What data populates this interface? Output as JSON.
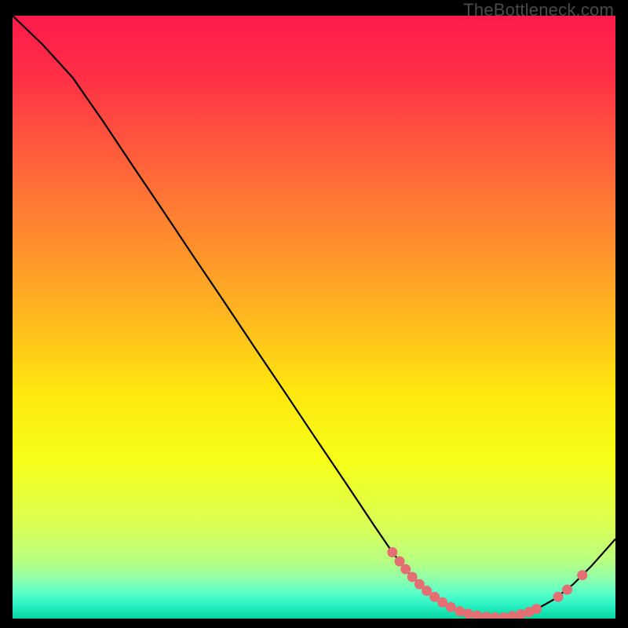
{
  "watermark": "TheBottleneck.com",
  "chart_data": {
    "type": "line",
    "title": "",
    "xlabel": "",
    "ylabel": "",
    "xlim": [
      0,
      100
    ],
    "ylim": [
      0,
      100
    ],
    "grid": false,
    "legend": false,
    "gradient_stops": [
      {
        "offset": 0.0,
        "color": "#ff1a4b"
      },
      {
        "offset": 0.1,
        "color": "#ff2f46"
      },
      {
        "offset": 0.22,
        "color": "#ff5a3c"
      },
      {
        "offset": 0.35,
        "color": "#ff8530"
      },
      {
        "offset": 0.5,
        "color": "#ffb81f"
      },
      {
        "offset": 0.62,
        "color": "#ffe60f"
      },
      {
        "offset": 0.74,
        "color": "#f6ff1a"
      },
      {
        "offset": 0.85,
        "color": "#d8ff58"
      },
      {
        "offset": 0.905,
        "color": "#b8ff82"
      },
      {
        "offset": 0.935,
        "color": "#8dffab"
      },
      {
        "offset": 0.955,
        "color": "#5fffc8"
      },
      {
        "offset": 0.975,
        "color": "#30f5c6"
      },
      {
        "offset": 1.0,
        "color": "#06d6a0"
      }
    ],
    "curve": [
      {
        "x": 0,
        "y": 100.0
      },
      {
        "x": 5,
        "y": 95.2
      },
      {
        "x": 10,
        "y": 89.7
      },
      {
        "x": 12,
        "y": 86.8
      },
      {
        "x": 15,
        "y": 82.5
      },
      {
        "x": 20,
        "y": 75.0
      },
      {
        "x": 25,
        "y": 67.6
      },
      {
        "x": 30,
        "y": 60.1
      },
      {
        "x": 35,
        "y": 52.7
      },
      {
        "x": 40,
        "y": 45.2
      },
      {
        "x": 45,
        "y": 37.8
      },
      {
        "x": 50,
        "y": 30.3
      },
      {
        "x": 55,
        "y": 22.9
      },
      {
        "x": 60,
        "y": 15.4
      },
      {
        "x": 63,
        "y": 11.0
      },
      {
        "x": 66,
        "y": 7.2
      },
      {
        "x": 69,
        "y": 4.2
      },
      {
        "x": 72,
        "y": 2.1
      },
      {
        "x": 75,
        "y": 0.9
      },
      {
        "x": 78,
        "y": 0.3
      },
      {
        "x": 81,
        "y": 0.2
      },
      {
        "x": 84,
        "y": 0.6
      },
      {
        "x": 87,
        "y": 1.6
      },
      {
        "x": 90,
        "y": 3.3
      },
      {
        "x": 93,
        "y": 5.7
      },
      {
        "x": 96,
        "y": 8.7
      },
      {
        "x": 100,
        "y": 13.2
      }
    ],
    "markers": [
      {
        "x": 63.0,
        "y": 11.0
      },
      {
        "x": 64.2,
        "y": 9.5
      },
      {
        "x": 65.2,
        "y": 8.2
      },
      {
        "x": 66.3,
        "y": 6.9
      },
      {
        "x": 67.5,
        "y": 5.7
      },
      {
        "x": 68.7,
        "y": 4.6
      },
      {
        "x": 70.0,
        "y": 3.6
      },
      {
        "x": 71.3,
        "y": 2.7
      },
      {
        "x": 72.7,
        "y": 1.9
      },
      {
        "x": 74.2,
        "y": 1.2
      },
      {
        "x": 75.6,
        "y": 0.8
      },
      {
        "x": 77.1,
        "y": 0.5
      },
      {
        "x": 78.6,
        "y": 0.3
      },
      {
        "x": 80.0,
        "y": 0.2
      },
      {
        "x": 81.5,
        "y": 0.2
      },
      {
        "x": 82.9,
        "y": 0.4
      },
      {
        "x": 84.3,
        "y": 0.7
      },
      {
        "x": 85.7,
        "y": 1.1
      },
      {
        "x": 86.9,
        "y": 1.6
      },
      {
        "x": 90.5,
        "y": 3.6
      },
      {
        "x": 92.0,
        "y": 4.8
      },
      {
        "x": 94.5,
        "y": 7.2
      }
    ],
    "marker_color": "#e36f74",
    "line_color": "#000000"
  }
}
